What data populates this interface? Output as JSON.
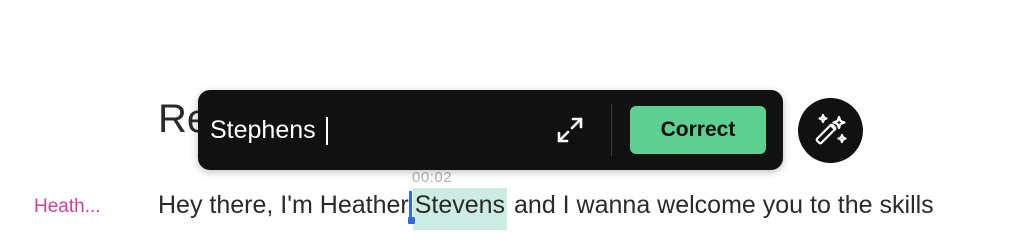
{
  "heading": {
    "partial_text": "Re"
  },
  "timestamp": "00:02",
  "speaker": {
    "label": "Heath..."
  },
  "transcript": {
    "before": "Hey there, I'm Heather",
    "highlighted": "Stevens",
    "after": " and I wanna welcome you to the skills"
  },
  "correction": {
    "input_value": "Stephens",
    "expand_icon": "expand-icon",
    "button_label": "Correct"
  },
  "magic_button": {
    "icon": "magic-wand-icon"
  },
  "colors": {
    "speaker": "#c8429a",
    "highlight": "#ccebe2",
    "cursor": "#2f6ae3",
    "correct_button": "#5ccf91",
    "popover_bg": "#111111"
  }
}
